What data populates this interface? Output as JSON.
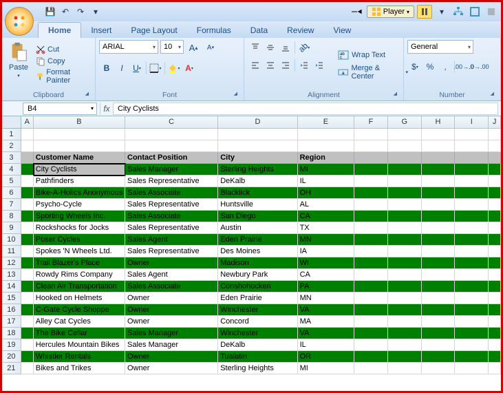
{
  "qat": {
    "save": "💾",
    "undo": "↶",
    "redo": "↷"
  },
  "player": {
    "label": "Player"
  },
  "tabs": [
    "Home",
    "Insert",
    "Page Layout",
    "Formulas",
    "Data",
    "Review",
    "View"
  ],
  "active_tab": 0,
  "clipboard": {
    "paste": "Paste",
    "cut": "Cut",
    "copy": "Copy",
    "format_painter": "Format Painter",
    "label": "Clipboard"
  },
  "font": {
    "name": "ARIAL",
    "size": "10",
    "label": "Font"
  },
  "alignment": {
    "wrap": "Wrap Text",
    "merge": "Merge & Center",
    "label": "Alignment"
  },
  "number": {
    "format": "General",
    "label": "Number"
  },
  "namebox": "B4",
  "formula": "City Cyclists",
  "columns": [
    "A",
    "B",
    "C",
    "D",
    "E",
    "F",
    "G",
    "H",
    "I",
    "J"
  ],
  "colwidths": [
    "cA",
    "cB",
    "cC",
    "cD",
    "cE",
    "cF",
    "cG",
    "cH",
    "cI",
    "cJ"
  ],
  "header_row_num": 3,
  "headers": [
    "Customer Name",
    "Contact Position",
    "City",
    "Region"
  ],
  "data_rows": [
    {
      "n": 4,
      "green": true,
      "selected": true,
      "v": [
        "City Cyclists",
        "Sales Manager",
        "Sterling Heights",
        "MI"
      ]
    },
    {
      "n": 5,
      "green": false,
      "v": [
        "Pathfinders",
        "Sales Representative",
        "DeKalb",
        "IL"
      ]
    },
    {
      "n": 6,
      "green": true,
      "v": [
        "Bike-A-Holics Anonymous",
        "Sales Associate",
        "Blacklick",
        "OH"
      ]
    },
    {
      "n": 7,
      "green": false,
      "v": [
        "Psycho-Cycle",
        "Sales Representative",
        "Huntsville",
        "AL"
      ]
    },
    {
      "n": 8,
      "green": true,
      "v": [
        "Sporting Wheels Inc.",
        "Sales Associate",
        "San Diego",
        "CA"
      ]
    },
    {
      "n": 9,
      "green": false,
      "v": [
        "Rockshocks for Jocks",
        "Sales Representative",
        "Austin",
        "TX"
      ]
    },
    {
      "n": 10,
      "green": true,
      "v": [
        "Poser Cycles",
        "Sales Agent",
        "Eden Prairie",
        "MN"
      ]
    },
    {
      "n": 11,
      "green": false,
      "v": [
        "Spokes 'N Wheels Ltd.",
        "Sales Representative",
        "Des Moines",
        "IA"
      ]
    },
    {
      "n": 12,
      "green": true,
      "v": [
        "Trail Blazer's Place",
        "Owner",
        "Madison",
        "WI"
      ]
    },
    {
      "n": 13,
      "green": false,
      "v": [
        "Rowdy Rims Company",
        "Sales Agent",
        "Newbury Park",
        "CA"
      ]
    },
    {
      "n": 14,
      "green": true,
      "v": [
        "Clean Air Transportation",
        "Sales Associate",
        "Conshohocken",
        "PA"
      ]
    },
    {
      "n": 15,
      "green": false,
      "v": [
        "Hooked on Helmets",
        "Owner",
        "Eden Prairie",
        "MN"
      ]
    },
    {
      "n": 16,
      "green": true,
      "v": [
        "C-Gate Cycle Shoppe",
        "Owner",
        "Winchester",
        "VA"
      ]
    },
    {
      "n": 17,
      "green": false,
      "v": [
        "Alley Cat Cycles",
        "Owner",
        "Concord",
        "MA"
      ]
    },
    {
      "n": 18,
      "green": true,
      "v": [
        "The Bike Cellar",
        "Sales Manager",
        "Winchester",
        "VA"
      ]
    },
    {
      "n": 19,
      "green": false,
      "v": [
        "Hercules Mountain Bikes",
        "Sales Manager",
        "DeKalb",
        "IL"
      ]
    },
    {
      "n": 20,
      "green": true,
      "v": [
        "Whistler Rentals",
        "Owner",
        "Tualatin",
        "OR"
      ]
    },
    {
      "n": 21,
      "green": false,
      "v": [
        "Bikes and Trikes",
        "Owner",
        "Sterling Heights",
        "MI"
      ]
    }
  ]
}
